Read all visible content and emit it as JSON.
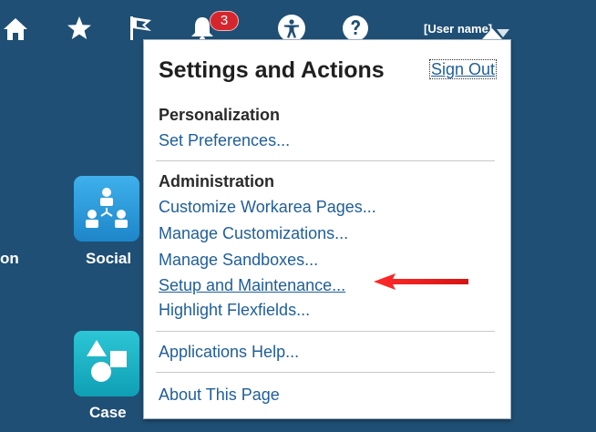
{
  "header": {
    "notification_count": "3",
    "user_name": "[User name]",
    "icons": [
      "home-icon",
      "favorites-star-icon",
      "watchlist-flag-icon",
      "notifications-bell-icon",
      "accessibility-icon",
      "help-icon"
    ]
  },
  "tiles": [
    {
      "label": "Social",
      "icon": "social-network-icon",
      "color": "#2b9ad8"
    },
    {
      "label": "Case",
      "icon": "shapes-icon",
      "color": "#1ab0c3"
    }
  ],
  "partial_label": "on",
  "menu": {
    "title": "Settings and Actions",
    "sign_out": "Sign Out",
    "personalization": {
      "heading": "Personalization",
      "items": [
        "Set Preferences..."
      ]
    },
    "administration": {
      "heading": "Administration",
      "items": [
        "Customize Workarea Pages...",
        "Manage Customizations...",
        "Manage Sandboxes...",
        "Setup and Maintenance...",
        "Highlight Flexfields..."
      ]
    },
    "help": "Applications Help...",
    "about": "About This Page"
  },
  "colors": {
    "background": "#1f4f74",
    "link": "#1f5e9a",
    "badge": "#d6262d",
    "arrow": "#e01b1b"
  }
}
